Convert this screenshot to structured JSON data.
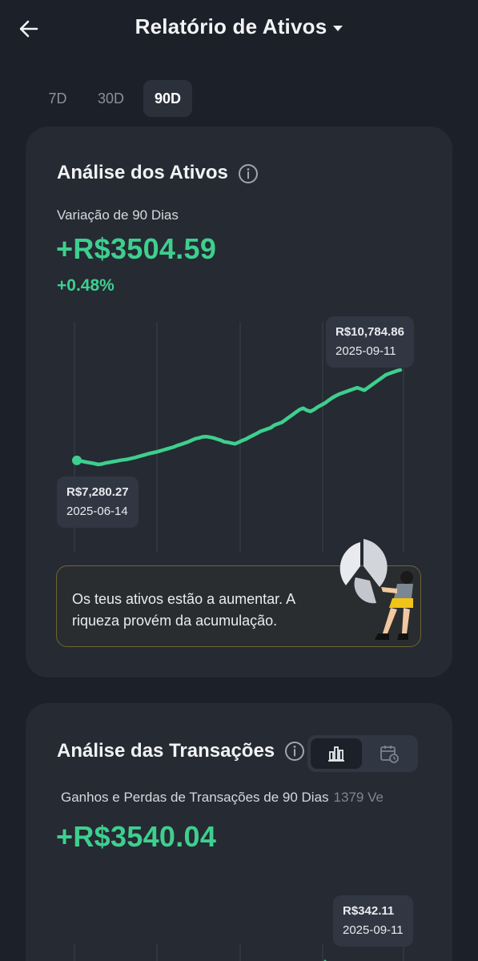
{
  "header": {
    "title": "Relatório de Ativos"
  },
  "tabs": [
    {
      "label": "7D",
      "active": false
    },
    {
      "label": "30D",
      "active": false
    },
    {
      "label": "90D",
      "active": true
    }
  ],
  "assets": {
    "title": "Análise dos Ativos",
    "period_label": "Variação de 90 Dias",
    "change_value": "+R$3504.59",
    "change_pct": "+0.48%",
    "chart_data": {
      "type": "line",
      "series": [
        {
          "values": [
            7280.27,
            7260,
            7230,
            7200,
            7180,
            7150,
            7120,
            7140,
            7180,
            7200,
            7230,
            7250,
            7280,
            7300,
            7320,
            7350,
            7380,
            7420,
            7460,
            7500,
            7540,
            7570,
            7600,
            7640,
            7680,
            7720,
            7760,
            7800,
            7860,
            7900,
            7950,
            8000,
            8060,
            8120,
            8150,
            8190,
            8200,
            8180,
            8150,
            8100,
            8060,
            8000,
            7980,
            7950,
            7920,
            7980,
            8050,
            8100,
            8180,
            8250,
            8320,
            8400,
            8450,
            8500,
            8550,
            8650,
            8700,
            8750,
            8850,
            8950,
            9050,
            9150,
            9250,
            9300,
            9220,
            9180,
            9250,
            9350,
            9420,
            9500,
            9600,
            9700,
            9780,
            9850,
            9900,
            9950,
            10000,
            10050,
            10100,
            10050,
            10000,
            10100,
            10200,
            10300,
            10400,
            10500,
            10600,
            10650,
            10700,
            10750,
            10784.86
          ]
        }
      ],
      "x_start": "2025-06-14",
      "x_end": "2025-09-11",
      "color": "#3ecf8e"
    },
    "low": {
      "amount": "R$7,280.27",
      "date": "2025-06-14"
    },
    "high": {
      "amount": "R$10,784.86",
      "date": "2025-09-11"
    },
    "banner_text": "Os teus ativos estão a aumentar. A riqueza provém da acumulação."
  },
  "transactions": {
    "title": "Análise das Transações",
    "period_label": "Ganhos e Perdas de Transações de 90 Dias",
    "count_label": "1379 Ve",
    "total_value": "+R$3540.04",
    "tooltip": {
      "amount": "R$342.11",
      "date": "2025-09-11"
    }
  },
  "colors": {
    "accent_green": "#3ecf8e",
    "background": "#1c2028",
    "card": "#252a33"
  }
}
